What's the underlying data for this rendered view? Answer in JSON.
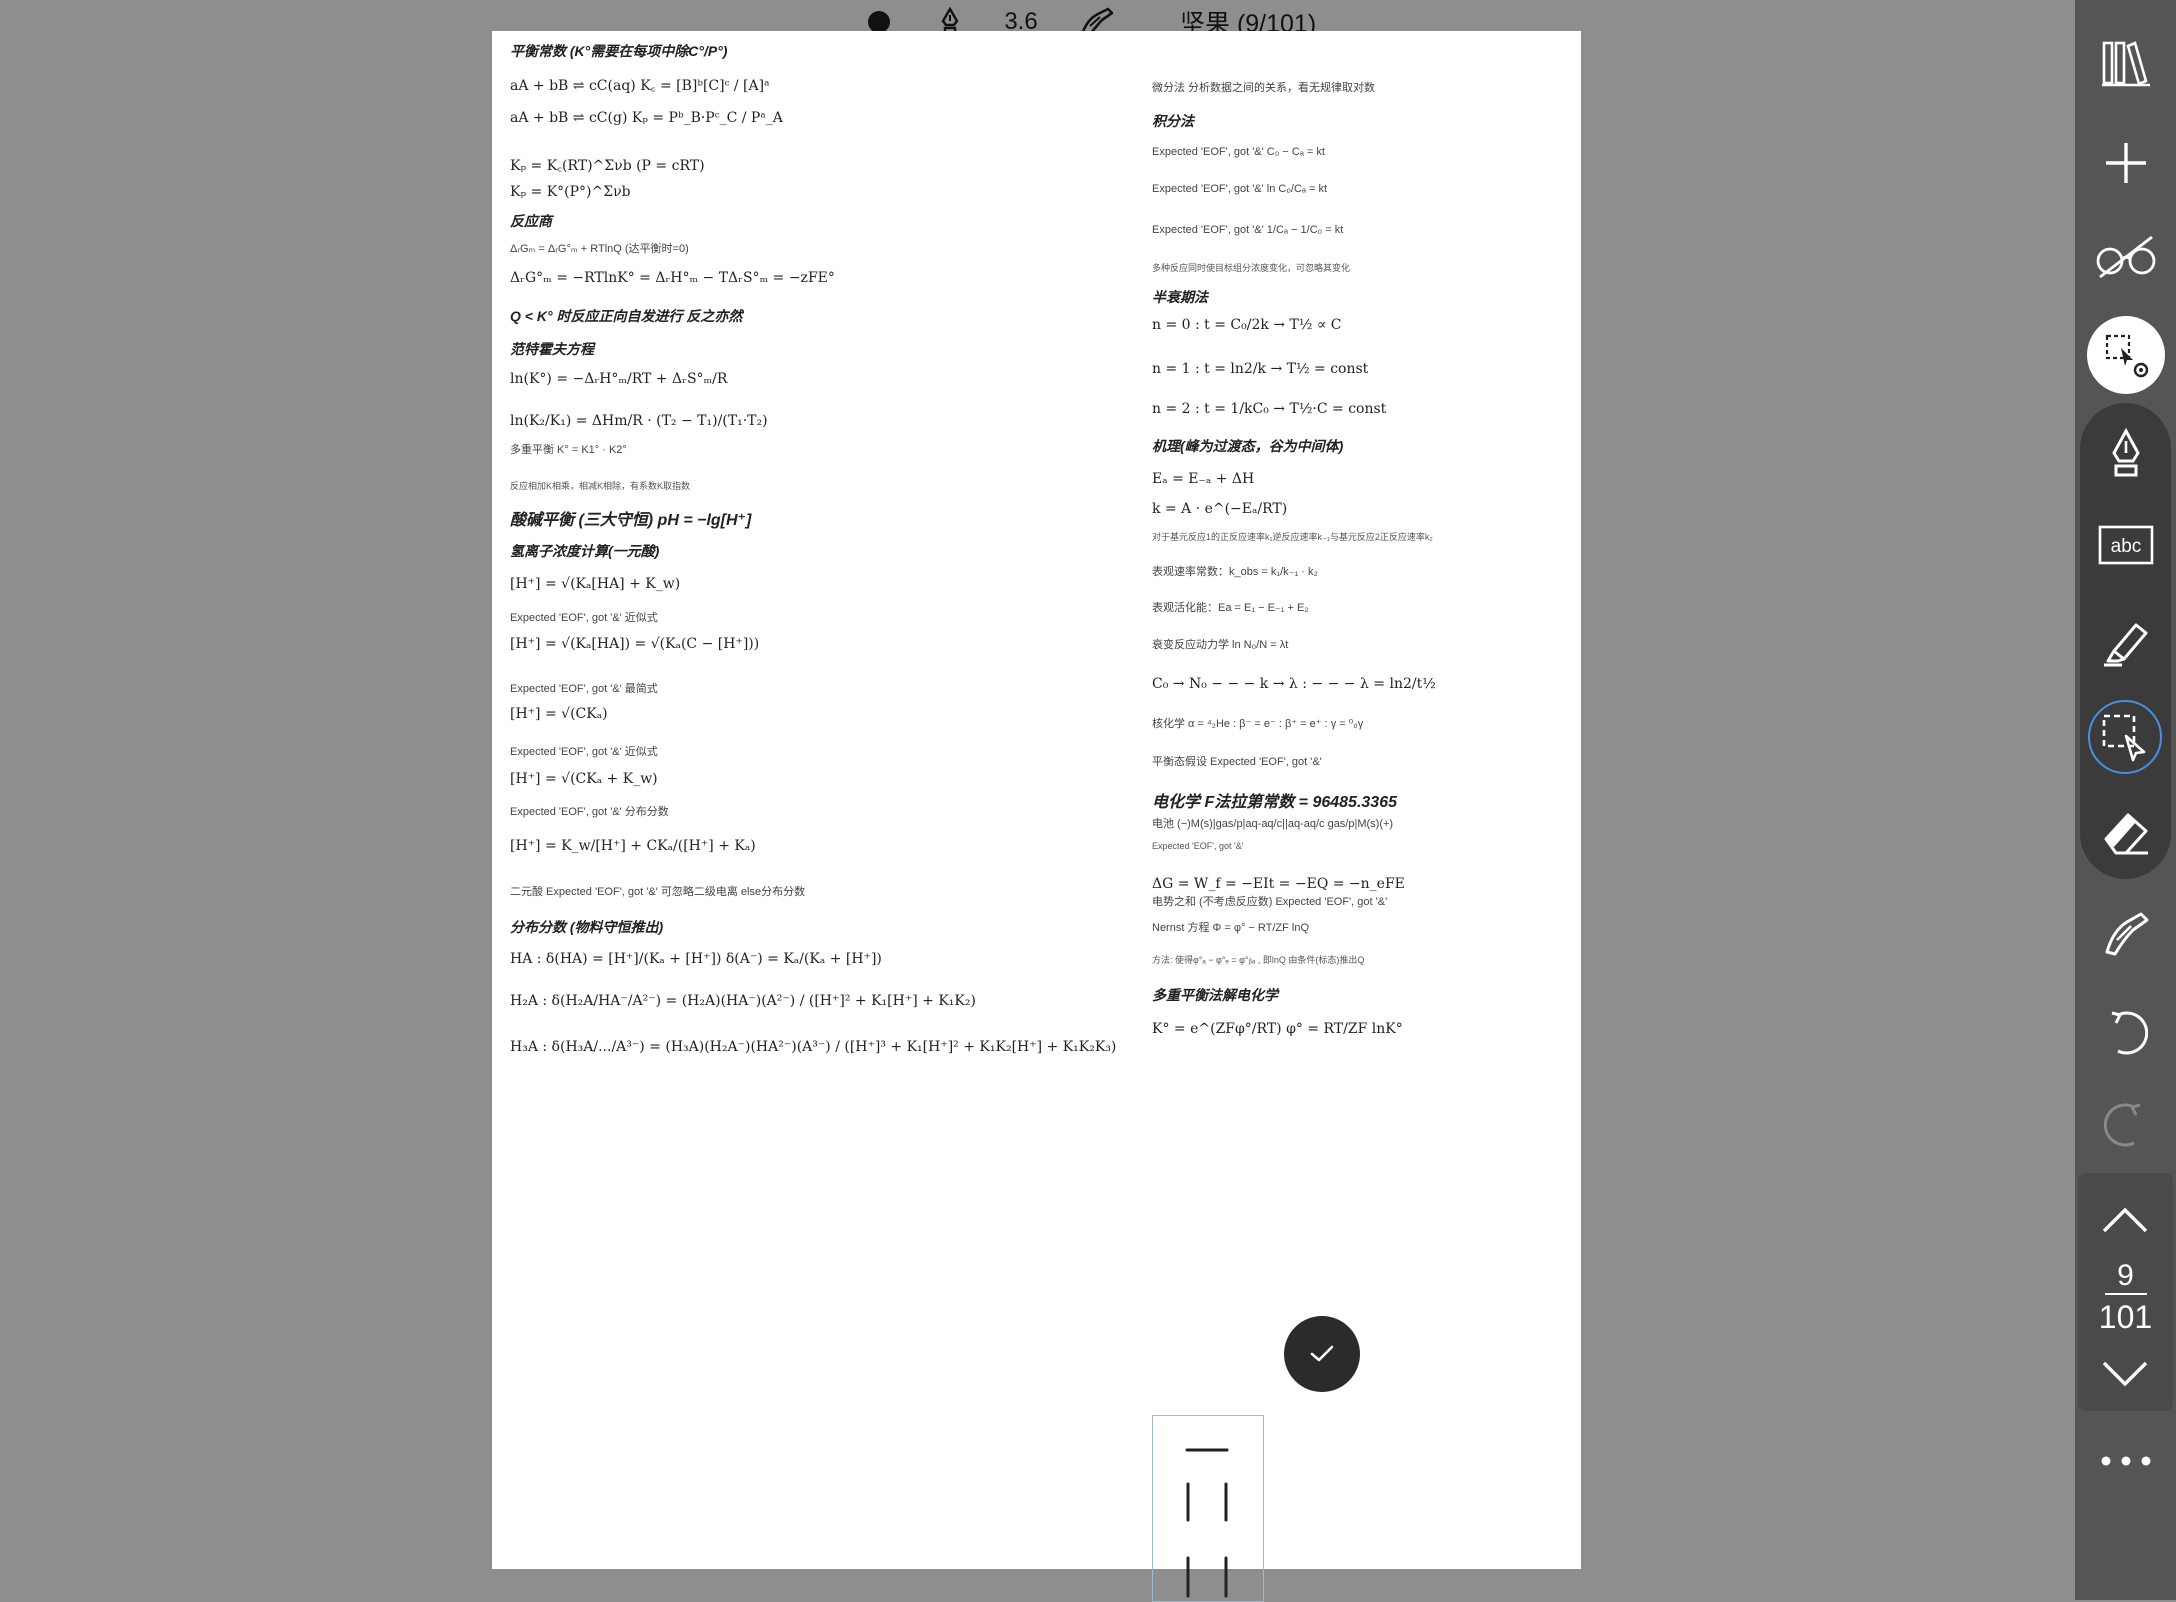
{
  "topbar": {
    "pen_width": "3.6",
    "title": "坚果 (9/101)"
  },
  "left_column": [
    {
      "type": "h",
      "text": "平衡常数 (K°需要在每项中除C°/P°)"
    },
    {
      "type": "f",
      "text": "aA + bB ⇌ cC(aq)   K꜀ = [B]ᵇ[C]ᶜ / [A]ᵃ"
    },
    {
      "type": "f",
      "text": "aA + bB ⇌ cC(g)   Kₚ = Pᵇ_B·Pᶜ_C / Pᵃ_A"
    },
    {
      "type": "f",
      "text": "Kₚ = K꜀(RT)^Σνb   (P = cRT)"
    },
    {
      "type": "f",
      "text": "Kₚ = K°(P°)^Σνb"
    },
    {
      "type": "h",
      "text": "反应商"
    },
    {
      "type": "mix",
      "text": "ΔᵣGₘ = ΔᵣG°ₘ + RTlnQ (达平衡时=0)"
    },
    {
      "type": "f",
      "text": "ΔᵣG°ₘ = −RTlnK° = ΔᵣH°ₘ − TΔᵣS°ₘ = −zFE°"
    },
    {
      "type": "h",
      "text": "Q < K° 时反应正向自发进行 反之亦然"
    },
    {
      "type": "h",
      "text": "范特霍夫方程"
    },
    {
      "type": "f",
      "text": "ln(K°) = −ΔᵣH°ₘ/RT + ΔᵣS°ₘ/R"
    },
    {
      "type": "f",
      "text": "ln(K₂/K₁) = ΔHm/R · (T₂ − T₁)/(T₁·T₂)"
    },
    {
      "type": "mix",
      "text": "多重平衡   K° = K1° · K2°"
    },
    {
      "type": "s",
      "text": "反应相加K相乘，相减K相除，有系数K取指数"
    },
    {
      "type": "big",
      "text": "酸碱平衡 (三大守恒)    pH = −lg[H⁺]"
    },
    {
      "type": "h",
      "text": "氢离子浓度计算(一元酸)"
    },
    {
      "type": "f",
      "text": "[H⁺] = √(Kₐ[HA] + K_w)"
    },
    {
      "type": "mix",
      "text": "Expected 'EOF', got '&'  近似式"
    },
    {
      "type": "f",
      "text": "[H⁺] = √(Kₐ[HA]) = √(Kₐ(C − [H⁺]))"
    },
    {
      "type": "mix",
      "text": "Expected 'EOF', got '&'  最简式"
    },
    {
      "type": "f",
      "text": "[H⁺] = √(CKₐ)"
    },
    {
      "type": "mix",
      "text": "Expected 'EOF', got '&'  近似式"
    },
    {
      "type": "f",
      "text": "[H⁺] = √(CKₐ + K_w)"
    },
    {
      "type": "mix",
      "text": "Expected 'EOF', got '&'  分布分数"
    },
    {
      "type": "f",
      "text": "[H⁺] = K_w/[H⁺] + CKₐ/([H⁺] + Kₐ)"
    },
    {
      "type": "mix",
      "text": "二元酸   Expected 'EOF', got '&'   可忽略二级电离 else分布分数"
    },
    {
      "type": "h",
      "text": "分布分数 (物料守恒推出)"
    },
    {
      "type": "f",
      "text": "HA : δ(HA) = [H⁺]/(Kₐ + [H⁺])    δ(A⁻) = Kₐ/(Kₐ + [H⁺])"
    },
    {
      "type": "f",
      "text": "H₂A : δ(H₂A/HA⁻/A²⁻) = (H₂A)(HA⁻)(A²⁻) / ([H⁺]² + K₁[H⁺] + K₁K₂)"
    },
    {
      "type": "f",
      "text": "H₃A : δ(H₃A/.../A³⁻) = (H₃A)(H₂A⁻)(HA²⁻)(A³⁻) / ([H⁺]³ + K₁[H⁺]² + K₁K₂[H⁺] + K₁K₂K₃)"
    }
  ],
  "right_column": [
    {
      "type": "mix",
      "text": "微分法   分析数据之间的关系，看无规律取对数"
    },
    {
      "type": "h",
      "text": "积分法"
    },
    {
      "type": "mix",
      "text": "Expected 'EOF', got '&'        C₀ − Cₐ = kt"
    },
    {
      "type": "mix",
      "text": "Expected 'EOF', got '&'        ln C₀/Cₐ = kt"
    },
    {
      "type": "mix",
      "text": "Expected 'EOF', got '&'        1/Cₐ − 1/C₀ = kt"
    },
    {
      "type": "s",
      "text": "多种反应同时使目标组分浓度变化，可忽略其变化"
    },
    {
      "type": "h",
      "text": "半衰期法"
    },
    {
      "type": "f",
      "text": "n = 0 : t = C₀/2k → T½ ∝ C"
    },
    {
      "type": "f",
      "text": "n = 1 : t = ln2/k → T½ = const"
    },
    {
      "type": "f",
      "text": "n = 2 : t = 1/kC₀ → T½·C = const"
    },
    {
      "type": "h",
      "text": "机理(峰为过渡态，谷为中间体)"
    },
    {
      "type": "f",
      "text": "Eₐ = E₋ₐ + ΔH"
    },
    {
      "type": "f",
      "text": "k = A · e^(−Eₐ/RT)"
    },
    {
      "type": "s",
      "text": "对于基元反应1的正反应速率k₁逆反应速率k₋₁与基元反应2正反应速率k₂"
    },
    {
      "type": "mix",
      "text": "表观速率常数：k_obs = k₁/k₋₁ · k₂"
    },
    {
      "type": "mix",
      "text": "表观活化能：Ea = E₁ − E₋₁ + E₂"
    },
    {
      "type": "mix",
      "text": "衰变反应动力学   ln N₀/N = λt"
    },
    {
      "type": "f",
      "text": "C₀ → N₀ − − − k → λ : − − − λ = ln2/t½"
    },
    {
      "type": "mix",
      "text": "核化学   α = ⁴₂He : β⁻ = e⁻ : β⁺ = e⁺ : γ = ⁰₀γ"
    },
    {
      "type": "mix",
      "text": "平衡态假设   Expected 'EOF', got '&'"
    },
    {
      "type": "big",
      "text": "电化学    F法拉第常数 = 96485.3365"
    },
    {
      "type": "mix",
      "text": "电池   (−)M(s)|gas/p|aq-aq/c||aq-aq/c gas/p|M(s)(+)"
    },
    {
      "type": "s",
      "text": "Expected 'EOF', got '&'"
    },
    {
      "type": "f",
      "text": "ΔG = W_f = −EIt = −EQ = −n_eFE"
    },
    {
      "type": "mix",
      "text": "电势之和 (不考虑反应数)   Expected 'EOF', got '&'"
    },
    {
      "type": "mix",
      "text": "Nernst 方程    Φ = φ° − RT/ZF lnQ"
    },
    {
      "type": "s",
      "text": "方法: 使得φ°ₐ − φ°ₑ = φ°ᵦₐ , 即lnQ 由条件(标态)推出Q"
    },
    {
      "type": "h",
      "text": "多重平衡法解电化学"
    },
    {
      "type": "f",
      "text": "K° = e^(ZFφ°/RT)   φ° = RT/ZF lnK°"
    }
  ],
  "pager": {
    "current": "9",
    "total": "101"
  }
}
